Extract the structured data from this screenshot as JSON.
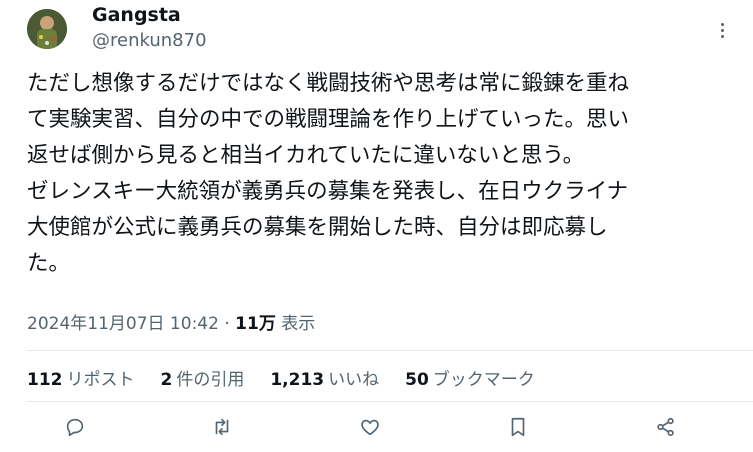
{
  "user": {
    "display_name": "Gangsta",
    "handle": "@renkun870"
  },
  "tweet": {
    "lines": [
      "ただし想像するだけではなく戦闘技術や思考は常に鍛錬を重ね",
      "て実験実習、自分の中での戦闘理論を作り上げていった。思い",
      "返せば側から見ると相当イカれていたに違いないと思う。",
      "ゼレンスキー大統領が義勇兵の募集を発表し、在日ウクライナ",
      "大使館が公式に義勇兵の募集を開始した時、自分は即応募し",
      "た。"
    ]
  },
  "meta": {
    "timestamp": "2024年11月07日 10:42",
    "separator": " · ",
    "views_count": "11万",
    "views_label": " 表示"
  },
  "stats": {
    "reposts_count": "112",
    "reposts_label": "リポスト",
    "quotes_count": "2",
    "quotes_label": "件の引用",
    "likes_count": "1,213",
    "likes_label": "いいね",
    "bookmarks_count": "50",
    "bookmarks_label": "ブックマーク"
  },
  "icons": {
    "more": "more-options-icon",
    "reply": "reply-icon",
    "repost": "repost-icon",
    "like": "heart-icon",
    "bookmark": "bookmark-icon",
    "share": "share-icon"
  },
  "colors": {
    "text": "#0f1419",
    "secondary": "#536471",
    "divider": "#e4e9ec"
  }
}
